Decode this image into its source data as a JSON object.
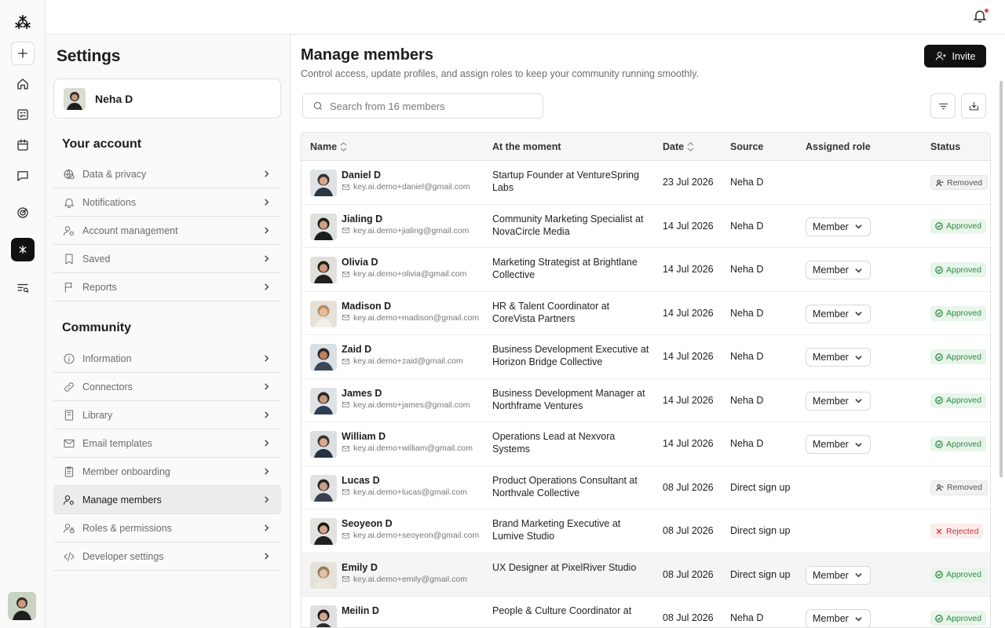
{
  "app": {
    "logo": "⁂",
    "current_user": "Neha D"
  },
  "settings": {
    "title": "Settings",
    "profile_name": "Neha D",
    "your_account_title": "Your account",
    "account_items": [
      {
        "label": "Data & privacy",
        "icon": "globe-lock-icon"
      },
      {
        "label": "Notifications",
        "icon": "bell-icon"
      },
      {
        "label": "Account management",
        "icon": "user-gear-icon"
      },
      {
        "label": "Saved",
        "icon": "bookmark-icon"
      },
      {
        "label": "Reports",
        "icon": "flag-icon"
      }
    ],
    "community_title": "Community",
    "community_items": [
      {
        "label": "Information",
        "icon": "info-icon"
      },
      {
        "label": "Connectors",
        "icon": "link-icon"
      },
      {
        "label": "Library",
        "icon": "book-icon"
      },
      {
        "label": "Email templates",
        "icon": "mail-icon"
      },
      {
        "label": "Member onboarding",
        "icon": "clipboard-icon"
      },
      {
        "label": "Manage members",
        "icon": "user-gear-icon",
        "active": true
      },
      {
        "label": "Roles & permissions",
        "icon": "user-lock-icon"
      },
      {
        "label": "Developer settings",
        "icon": "code-icon"
      }
    ]
  },
  "main": {
    "title": "Manage members",
    "subtitle": "Control access, update profiles, and assign roles to keep your community running smoothly.",
    "invite_label": "Invite",
    "search_placeholder": "Search from 16 members",
    "columns": {
      "name": "Name",
      "at_moment": "At the moment",
      "date": "Date",
      "source": "Source",
      "role": "Assigned role",
      "status": "Status"
    },
    "members": [
      {
        "name": "Daniel D",
        "email": "key.ai.demo+daniel@gmail.com",
        "at": "Startup Founder at VentureSpring Labs",
        "date": "23 Jul 2026",
        "source": "Neha D",
        "role": "",
        "status": "Removed",
        "kind": "removed"
      },
      {
        "name": "Jialing D",
        "email": "key.ai.demo+jialing@gmail.com",
        "at": "Community Marketing Specialist at NovaCircle Media",
        "date": "14 Jul 2026",
        "source": "Neha D",
        "role": "Member",
        "status": "Approved",
        "kind": "approved"
      },
      {
        "name": "Olivia D",
        "email": "key.ai.demo+olivia@gmail.com",
        "at": "Marketing Strategist at Brightlane Collective",
        "date": "14 Jul 2026",
        "source": "Neha D",
        "role": "Member",
        "status": "Approved",
        "kind": "approved"
      },
      {
        "name": "Madison D",
        "email": "key.ai.demo+madison@gmail.com",
        "at": "HR & Talent Coordinator at CoreVista Partners",
        "date": "14 Jul 2026",
        "source": "Neha D",
        "role": "Member",
        "status": "Approved",
        "kind": "approved"
      },
      {
        "name": "Zaid D",
        "email": "key.ai.demo+zaid@gmail.com",
        "at": "Business Development Executive at Horizon Bridge Collective",
        "date": "14 Jul 2026",
        "source": "Neha D",
        "role": "Member",
        "status": "Approved",
        "kind": "approved"
      },
      {
        "name": "James D",
        "email": "key.ai.demo+james@gmail.com",
        "at": "Business Development Manager at Northframe Ventures",
        "date": "14 Jul 2026",
        "source": "Neha D",
        "role": "Member",
        "status": "Approved",
        "kind": "approved"
      },
      {
        "name": "William D",
        "email": "key.ai.demo+william@gmail.com",
        "at": "Operations Lead at Nexvora Systems",
        "date": "14 Jul 2026",
        "source": "Neha D",
        "role": "Member",
        "status": "Approved",
        "kind": "approved"
      },
      {
        "name": "Lucas D",
        "email": "key.ai.demo+lucas@gmail.com",
        "at": "Product Operations Consultant at Northvale Collective",
        "date": "08 Jul 2026",
        "source": "Direct sign up",
        "role": "",
        "status": "Removed",
        "kind": "removed"
      },
      {
        "name": "Seoyeon D",
        "email": "key.ai.demo+seoyeon@gmail.com",
        "at": "Brand Marketing Executive at Lumive Studio",
        "date": "08 Jul 2026",
        "source": "Direct sign up",
        "role": "",
        "status": "Rejected",
        "kind": "rejected"
      },
      {
        "name": "Emily D",
        "email": "key.ai.demo+emily@gmail.com",
        "at": "UX Designer at PixelRiver Studio",
        "date": "08 Jul 2026",
        "source": "Direct sign up",
        "role": "Member",
        "status": "Approved",
        "kind": "approved",
        "highlight": true
      },
      {
        "name": "Meilin D",
        "email": "",
        "at": "People & Culture Coordinator at",
        "date": "08 Jul 2026",
        "source": "Neha D",
        "role": "Member",
        "status": "Approved",
        "kind": "approved"
      }
    ]
  }
}
